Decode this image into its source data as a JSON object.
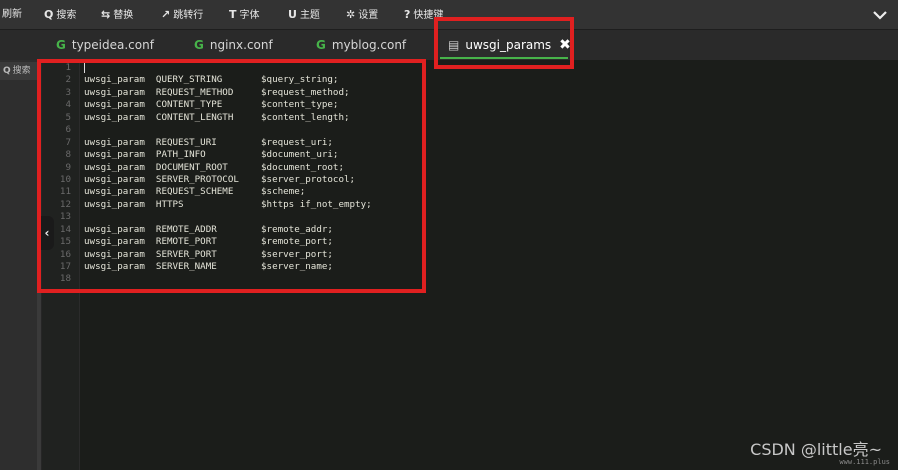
{
  "toolbar": {
    "items": [
      {
        "label": "刷新",
        "icon": ""
      },
      {
        "label": "搜索",
        "icon": "Q"
      },
      {
        "label": "替换",
        "icon": "⇆"
      },
      {
        "label": "跳转行",
        "icon": "↗"
      },
      {
        "label": "字体",
        "icon": "T"
      },
      {
        "label": "主题",
        "icon": "U"
      },
      {
        "label": "设置",
        "icon": "✲"
      },
      {
        "label": "快捷键",
        "icon": "?"
      }
    ],
    "chevron_icon": "chevron-down-icon"
  },
  "tabs": [
    {
      "label": "typeidea.conf",
      "icon": "G",
      "active": false
    },
    {
      "label": "nginx.conf",
      "icon": "G",
      "active": false
    },
    {
      "label": "myblog.conf",
      "icon": "G",
      "active": false
    },
    {
      "label": "uwsgi_params",
      "icon": "▤",
      "active": true,
      "close": "✖"
    }
  ],
  "sidebar": {
    "search_label": "搜索",
    "search_icon": "Q"
  },
  "editor": {
    "lines": [
      {
        "n": "1",
        "text": ""
      },
      {
        "n": "2",
        "text": "uwsgi_param  QUERY_STRING       $query_string;"
      },
      {
        "n": "3",
        "text": "uwsgi_param  REQUEST_METHOD     $request_method;"
      },
      {
        "n": "4",
        "text": "uwsgi_param  CONTENT_TYPE       $content_type;"
      },
      {
        "n": "5",
        "text": "uwsgi_param  CONTENT_LENGTH     $content_length;"
      },
      {
        "n": "6",
        "text": ""
      },
      {
        "n": "7",
        "text": "uwsgi_param  REQUEST_URI        $request_uri;"
      },
      {
        "n": "8",
        "text": "uwsgi_param  PATH_INFO          $document_uri;"
      },
      {
        "n": "9",
        "text": "uwsgi_param  DOCUMENT_ROOT      $document_root;"
      },
      {
        "n": "10",
        "text": "uwsgi_param  SERVER_PROTOCOL    $server_protocol;"
      },
      {
        "n": "11",
        "text": "uwsgi_param  REQUEST_SCHEME     $scheme;"
      },
      {
        "n": "12",
        "text": "uwsgi_param  HTTPS              $https if_not_empty;"
      },
      {
        "n": "13",
        "text": ""
      },
      {
        "n": "14",
        "text": "uwsgi_param  REMOTE_ADDR        $remote_addr;"
      },
      {
        "n": "15",
        "text": "uwsgi_param  REMOTE_PORT        $remote_port;"
      },
      {
        "n": "16",
        "text": "uwsgi_param  SERVER_PORT        $server_port;"
      },
      {
        "n": "17",
        "text": "uwsgi_param  SERVER_NAME        $server_name;"
      },
      {
        "n": "18",
        "text": ""
      }
    ]
  },
  "watermark": {
    "text": "CSDN @little亮~",
    "small": "www.111.plus"
  },
  "colors": {
    "accent_green": "#47b34a",
    "annotation_red": "#e02020"
  }
}
